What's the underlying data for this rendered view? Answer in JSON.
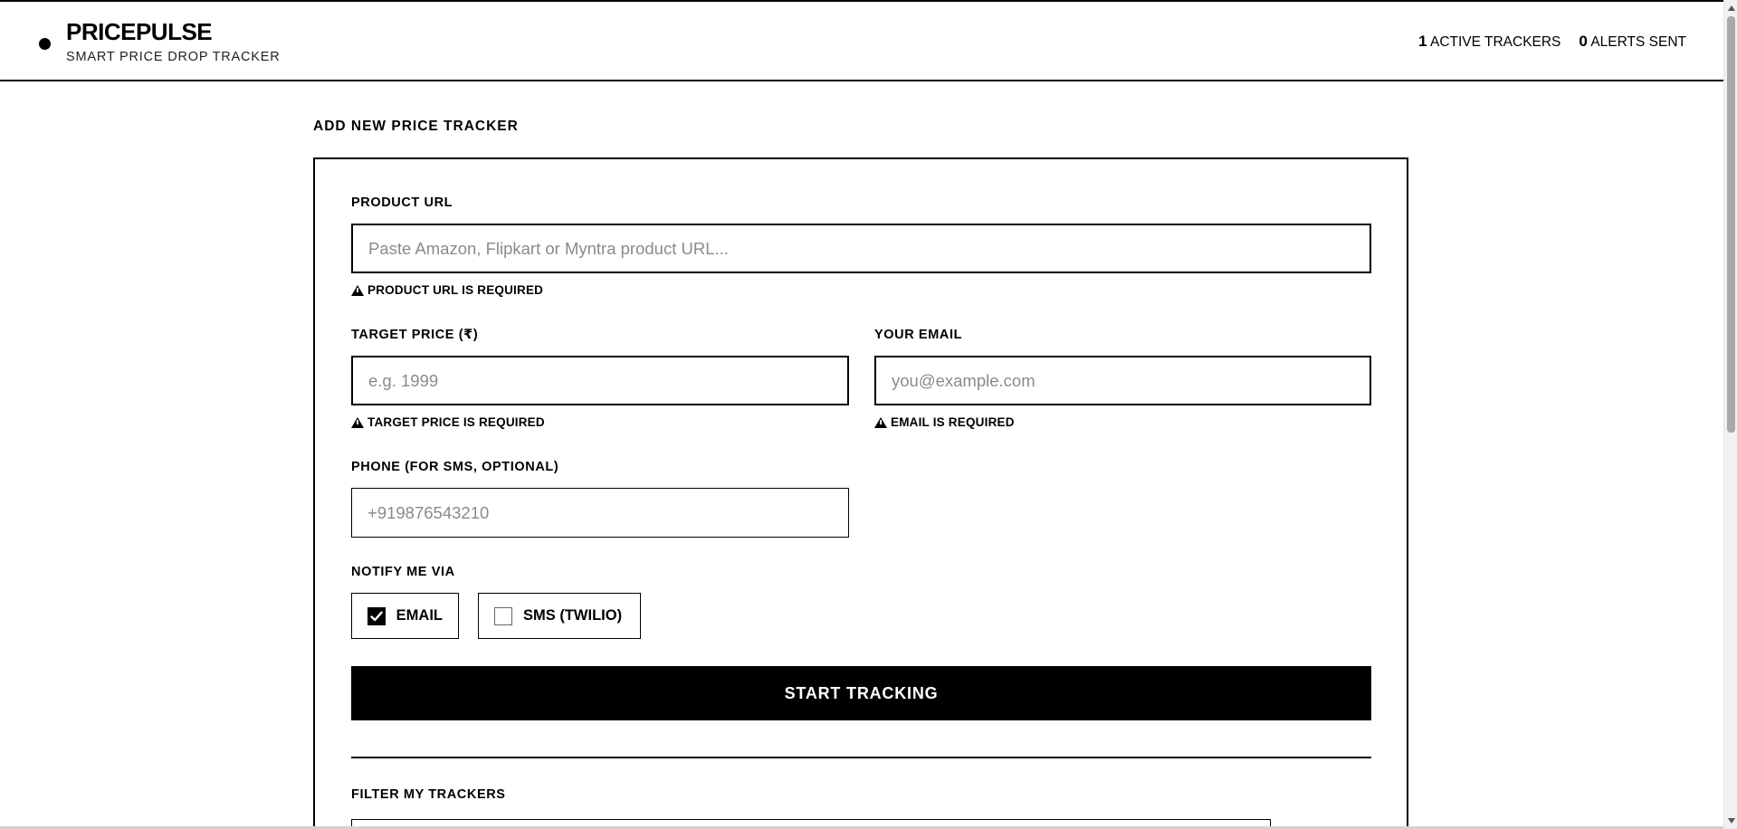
{
  "header": {
    "brand_name": "PRICEPULSE",
    "brand_subtitle": "SMART PRICE DROP TRACKER",
    "stats": {
      "active_trackers_count": "1",
      "active_trackers_label": "ACTIVE TRACKERS",
      "alerts_sent_count": "0",
      "alerts_sent_label": "ALERTS SENT"
    }
  },
  "form": {
    "section_title": "ADD NEW PRICE TRACKER",
    "product_url": {
      "label": "PRODUCT URL",
      "placeholder": "Paste Amazon, Flipkart or Myntra product URL...",
      "value": "",
      "error": "PRODUCT URL IS REQUIRED"
    },
    "target_price": {
      "label": "TARGET PRICE (₹)",
      "placeholder": "e.g. 1999",
      "value": "",
      "error": "TARGET PRICE IS REQUIRED"
    },
    "email": {
      "label": "YOUR EMAIL",
      "placeholder": "you@example.com",
      "value": "",
      "error": "EMAIL IS REQUIRED"
    },
    "phone": {
      "label": "PHONE (FOR SMS, OPTIONAL)",
      "placeholder": "+919876543210",
      "value": ""
    },
    "notify": {
      "label": "NOTIFY ME VIA",
      "options": [
        {
          "label": "EMAIL",
          "checked": true
        },
        {
          "label": "SMS (TWILIO)",
          "checked": false
        }
      ]
    },
    "submit_label": "START TRACKING"
  },
  "filter": {
    "title": "FILTER MY TRACKERS"
  },
  "icons": {
    "brand": "dot-icon",
    "error": "warning-triangle-icon",
    "check": "checkmark-icon"
  }
}
